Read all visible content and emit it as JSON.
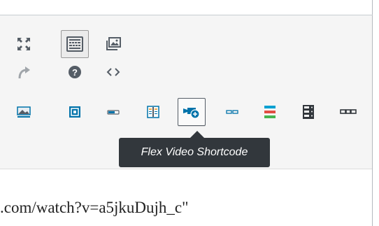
{
  "toolbar": {
    "row1": [
      {
        "icon": "fullscreen-icon",
        "pressed": false
      },
      {
        "icon": "keyboard-icon",
        "pressed": true
      },
      {
        "icon": "gallery-icon",
        "pressed": false
      }
    ],
    "row2": [
      {
        "icon": "redo-icon"
      },
      {
        "icon": "help-icon"
      },
      {
        "icon": "code-icon"
      }
    ],
    "row3": [
      {
        "icon": "image-icon"
      },
      {
        "icon": "flex-video-icon"
      },
      {
        "icon": "slider-icon"
      },
      {
        "icon": "columns-icon"
      },
      {
        "icon": "video-camera-add-icon",
        "hovered": true
      },
      {
        "icon": "divider-icon"
      },
      {
        "icon": "progress-bars-icon"
      },
      {
        "icon": "server-list-icon"
      },
      {
        "icon": "link-chain-icon"
      }
    ]
  },
  "tooltip": {
    "text": "Flex Video Shortcode"
  },
  "editor": {
    "text": ".com/watch?v=a5jkuDujh_c\""
  },
  "colors": {
    "toolbar_bg": "#f5f5f5",
    "icon_gray": "#555d66",
    "accent_blue": "#0073aa",
    "tooltip_bg": "#32373c"
  }
}
